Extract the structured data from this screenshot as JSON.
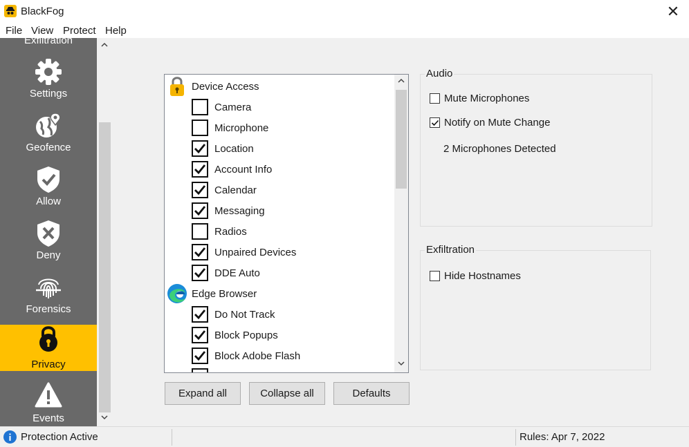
{
  "window": {
    "title": "BlackFog",
    "close_glyph": "✕"
  },
  "menu": [
    "File",
    "View",
    "Protect",
    "Help"
  ],
  "sidebar": {
    "partial_label": "Exfiltration",
    "items": [
      {
        "label": "Settings",
        "icon": "gear-icon"
      },
      {
        "label": "Geofence",
        "icon": "globe-pin-icon"
      },
      {
        "label": "Allow",
        "icon": "shield-check-icon"
      },
      {
        "label": "Deny",
        "icon": "shield-x-icon"
      },
      {
        "label": "Forensics",
        "icon": "fingerprint-icon"
      },
      {
        "label": "Privacy",
        "icon": "lock-icon",
        "active": true
      },
      {
        "label": "Events",
        "icon": "warning-icon"
      }
    ]
  },
  "privacy_list": {
    "groups": [
      {
        "label": "Device Access",
        "icon": "padlock-icon",
        "items": [
          {
            "label": "Camera",
            "checked": false
          },
          {
            "label": "Microphone",
            "checked": false
          },
          {
            "label": "Location",
            "checked": true
          },
          {
            "label": "Account Info",
            "checked": true
          },
          {
            "label": "Calendar",
            "checked": true
          },
          {
            "label": "Messaging",
            "checked": true
          },
          {
            "label": "Radios",
            "checked": false
          },
          {
            "label": "Unpaired Devices",
            "checked": true
          },
          {
            "label": "DDE Auto",
            "checked": true
          }
        ]
      },
      {
        "label": "Edge Browser",
        "icon": "edge-browser-icon",
        "items": [
          {
            "label": "Do Not Track",
            "checked": true
          },
          {
            "label": "Block Popups",
            "checked": true
          },
          {
            "label": "Block Adobe Flash",
            "checked": true
          }
        ]
      }
    ]
  },
  "buttons": {
    "expand_all": "Expand all",
    "collapse_all": "Collapse all",
    "defaults": "Defaults"
  },
  "audio": {
    "title": "Audio",
    "mute_microphones": {
      "label": "Mute Microphones",
      "checked": false
    },
    "notify_on_mute_change": {
      "label": "Notify on Mute Change",
      "checked": true
    },
    "detected_text": "2 Microphones Detected"
  },
  "exfiltration": {
    "title": "Exfiltration",
    "hide_hostnames": {
      "label": "Hide Hostnames",
      "checked": false
    }
  },
  "status": {
    "protection": "Protection Active",
    "rules": "Rules: Apr 7, 2022"
  },
  "colors": {
    "sidebar_bg": "#696969",
    "accent": "#ffc000",
    "info_blue": "#1e73d2"
  }
}
